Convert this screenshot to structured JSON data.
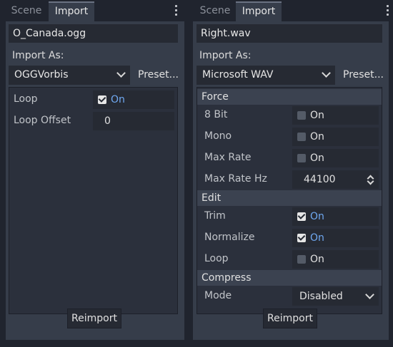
{
  "left": {
    "tabs": [
      "Scene",
      "Import"
    ],
    "file": "O_Canada.ogg",
    "import_as_label": "Import As:",
    "importer": "OGGVorbis",
    "preset": "Preset...",
    "props": [
      {
        "label": "Loop",
        "type": "check",
        "checked": true,
        "text": "On"
      },
      {
        "label": "Loop Offset",
        "type": "number",
        "value": "0"
      }
    ],
    "reimport": "Reimport"
  },
  "right": {
    "tabs": [
      "Scene",
      "Import"
    ],
    "file": "Right.wav",
    "import_as_label": "Import As:",
    "importer": "Microsoft WAV",
    "preset": "Preset...",
    "categories": {
      "force": "Force",
      "edit": "Edit",
      "compress": "Compress"
    },
    "force": [
      {
        "label": "8 Bit",
        "checked": false,
        "text": "On"
      },
      {
        "label": "Mono",
        "checked": false,
        "text": "On"
      },
      {
        "label": "Max Rate",
        "checked": false,
        "text": "On"
      },
      {
        "label": "Max Rate Hz",
        "value": "44100"
      }
    ],
    "edit": [
      {
        "label": "Trim",
        "checked": true,
        "text": "On"
      },
      {
        "label": "Normalize",
        "checked": true,
        "text": "On"
      },
      {
        "label": "Loop",
        "checked": false,
        "text": "On"
      }
    ],
    "compress": [
      {
        "label": "Mode",
        "value": "Disabled"
      }
    ],
    "reimport": "Reimport"
  },
  "colors": {
    "accent": "#6fa8f0",
    "panel": "#363d4a",
    "background": "#20242e"
  }
}
